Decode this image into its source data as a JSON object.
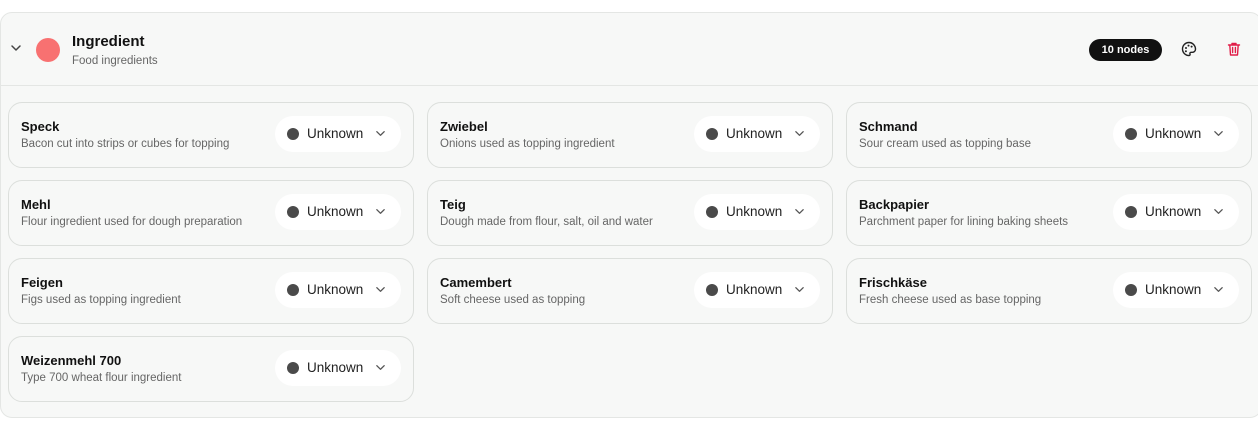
{
  "group": {
    "title": "Ingredient",
    "subtitle": "Food ingredients",
    "node_count_label": "10 nodes",
    "color": "#f87171"
  },
  "icons": {
    "collapse": "chevron-down-icon",
    "palette": "palette-icon",
    "delete": "trash-icon",
    "status_dropdown": "chevron-down-icon"
  },
  "colors": {
    "status_dot": "#4a4a4a",
    "delete": "#e11d48",
    "badge_bg": "#111111"
  },
  "nodes": [
    {
      "name": "Speck",
      "description": "Bacon cut into strips or cubes for topping",
      "status": "Unknown"
    },
    {
      "name": "Zwiebel",
      "description": "Onions used as topping ingredient",
      "status": "Unknown"
    },
    {
      "name": "Schmand",
      "description": "Sour cream used as topping base",
      "status": "Unknown"
    },
    {
      "name": "Mehl",
      "description": "Flour ingredient used for dough preparation",
      "status": "Unknown"
    },
    {
      "name": "Teig",
      "description": "Dough made from flour, salt, oil and water",
      "status": "Unknown"
    },
    {
      "name": "Backpapier",
      "description": "Parchment paper for lining baking sheets",
      "status": "Unknown"
    },
    {
      "name": "Feigen",
      "description": "Figs used as topping ingredient",
      "status": "Unknown"
    },
    {
      "name": "Camembert",
      "description": "Soft cheese used as topping",
      "status": "Unknown"
    },
    {
      "name": "Frischkäse",
      "description": "Fresh cheese used as base topping",
      "status": "Unknown"
    },
    {
      "name": "Weizenmehl 700",
      "description": "Type 700 wheat flour ingredient",
      "status": "Unknown"
    }
  ]
}
